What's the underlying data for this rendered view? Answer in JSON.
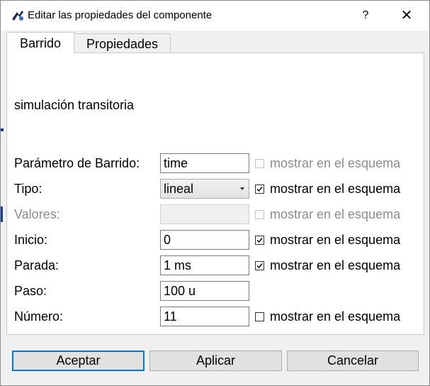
{
  "window": {
    "title": "Editar las propiedades del componente",
    "help_label": "?",
    "close_label": "✕"
  },
  "tabs": [
    {
      "label": "Barrido",
      "active": true
    },
    {
      "label": "Propiedades",
      "active": false
    }
  ],
  "panel": {
    "simulation_label": "simulación transitoria",
    "rows": [
      {
        "label": "Parámetro de Barrido:",
        "value": "time",
        "checkbox_label": "mostrar en el esquema",
        "checked": false,
        "checkbox_enabled": false,
        "enabled": true
      },
      {
        "label": "Tipo:",
        "value": "lineal",
        "checkbox_label": "mostrar en el esquema",
        "checked": true,
        "checkbox_enabled": true,
        "enabled": true,
        "is_select": true
      },
      {
        "label": "Valores:",
        "value": "",
        "checkbox_label": "mostrar en el esquema",
        "checked": false,
        "checkbox_enabled": false,
        "enabled": false
      },
      {
        "label": "Inicio:",
        "value": "0",
        "checkbox_label": "mostrar en el esquema",
        "checked": true,
        "checkbox_enabled": true,
        "enabled": true
      },
      {
        "label": "Parada:",
        "value": "1 ms",
        "checkbox_label": "mostrar en el esquema",
        "checked": true,
        "checkbox_enabled": true,
        "enabled": true
      },
      {
        "label": "Paso:",
        "value": "100 u",
        "enabled": true
      },
      {
        "label": "Número:",
        "value": "11",
        "checkbox_label": "mostrar en el esquema",
        "checked": false,
        "checkbox_enabled": true,
        "enabled": true
      }
    ]
  },
  "buttons": {
    "accept": "Aceptar",
    "apply": "Aplicar",
    "cancel": "Cancelar"
  },
  "colors": {
    "accent": "#0078d7",
    "disabled_text": "#8c8c8c"
  }
}
